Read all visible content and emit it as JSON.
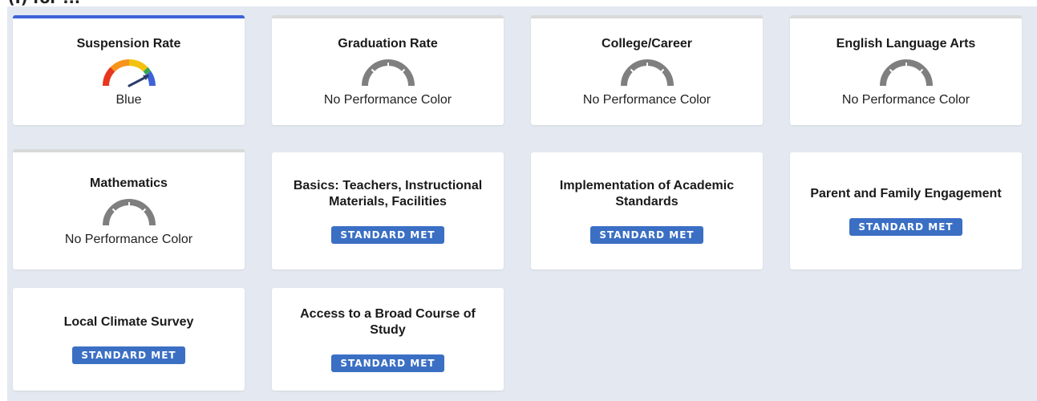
{
  "indicators": [
    {
      "title": "Suspension Rate",
      "status": "Blue"
    },
    {
      "title": "Graduation Rate",
      "status": "No Performance Color"
    },
    {
      "title": "College/Career",
      "status": "No Performance Color"
    },
    {
      "title": "English Language Arts",
      "status": "No Performance Color"
    },
    {
      "title": "Mathematics",
      "status": "No Performance Color"
    }
  ],
  "local_indicators": [
    {
      "title": "Basics: Teachers, Instructional Materials, Facilities",
      "status": "STANDARD MET"
    },
    {
      "title": "Implementation of Academic Standards",
      "status": "STANDARD MET"
    },
    {
      "title": "Parent and Family Engagement",
      "status": "STANDARD MET"
    },
    {
      "title": "Local Climate Survey",
      "status": "STANDARD MET"
    },
    {
      "title": "Access to a Broad Course of Study",
      "status": "STANDARD MET"
    }
  ],
  "header_partial": "(I) for ...",
  "colors": {
    "gauge_red": "#e8361f",
    "gauge_orange": "#f7941d",
    "gauge_yellow": "#f4c20d",
    "gauge_green": "#35a852",
    "gauge_blue": "#3e62d8",
    "gauge_gray": "#7f7f7f",
    "badge_blue": "#3a6fc4",
    "active_border": "#3e62d8"
  }
}
